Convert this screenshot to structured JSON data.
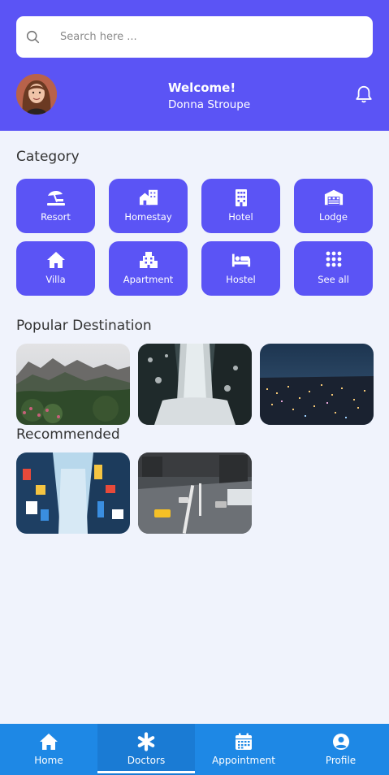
{
  "search": {
    "placeholder": "Search here ..."
  },
  "user": {
    "greeting": "Welcome!",
    "name": "Donna Stroupe"
  },
  "sections": {
    "category": "Category",
    "popular": "Popular Destination",
    "recommended": "Recommended"
  },
  "categories": [
    {
      "label": "Resort",
      "icon": "umbrella-beach-icon"
    },
    {
      "label": "Homestay",
      "icon": "house-building-icon"
    },
    {
      "label": "Hotel",
      "icon": "hotel-icon"
    },
    {
      "label": "Lodge",
      "icon": "warehouse-icon"
    },
    {
      "label": "Villa",
      "icon": "home-icon"
    },
    {
      "label": "Apartment",
      "icon": "city-building-icon"
    },
    {
      "label": "Hostel",
      "icon": "bed-icon"
    },
    {
      "label": "See all",
      "icon": "grid-dots-icon"
    }
  ],
  "nav": [
    {
      "label": "Home",
      "icon": "home-icon"
    },
    {
      "label": "Doctors",
      "icon": "asterisk-icon",
      "active": true
    },
    {
      "label": "Appointment",
      "icon": "calendar-icon"
    },
    {
      "label": "Profile",
      "icon": "user-circle-icon"
    }
  ],
  "colors": {
    "primary": "#5b54f5",
    "nav": "#1e88e5",
    "background": "#f0f3fc"
  }
}
